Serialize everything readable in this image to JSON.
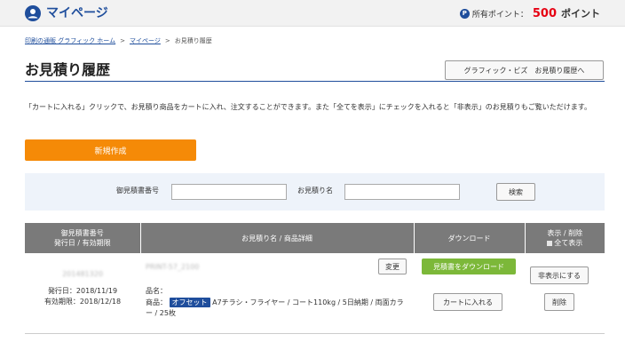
{
  "header": {
    "title": "マイページ",
    "points_icon": "P",
    "points_label": "所有ポイント：",
    "points_value": "500",
    "points_unit": "ポイント"
  },
  "breadcrumb": {
    "items": [
      "印刷の通販 グラフィック ホーム",
      "マイページ",
      "お見積り履歴"
    ],
    "separator": ">"
  },
  "page": {
    "title": "お見積り履歴",
    "history_button": "グラフィック・ビズ　お見積り履歴へ",
    "description": "「カートに入れる」クリックで、お見積り商品をカートに入れ、注文することができます。また「全てを表示」にチェックを入れると「非表示」のお見積りもご覧いただけます。",
    "new_button": "新規作成"
  },
  "search": {
    "number_label": "御見積書番号",
    "number_value": "",
    "name_label": "お見積り名",
    "name_value": "",
    "button": "検索"
  },
  "table": {
    "headers": {
      "number_line1": "御見積書番号",
      "number_line2": "発行日 / 有効期限",
      "name": "お見積り名 / 商品詳細",
      "download": "ダウンロード",
      "show_line1": "表示 / 削除",
      "show_line2": "全て表示"
    },
    "rows": [
      {
        "number": "201481320",
        "issue_date": "発行日：2018/11/19",
        "expiry": "有効期限：2018/12/18",
        "quote_name": "PRINT-57_2100",
        "change_button": "変更",
        "item_label": "品名：",
        "product_prefix": "商品：",
        "product_badge": "オフセット",
        "product_detail": "A7チラシ・フライヤー / コート110kg / 5日納期 / 両面カラー / 25枚",
        "download_button": "見積書をダウンロード",
        "cart_button": "カートに入れる",
        "hide_button": "非表示にする",
        "delete_button": "削除"
      }
    ]
  },
  "colors": {
    "brand": "#1f4e9c",
    "orange": "#f58a07",
    "green": "#7cb839",
    "points_red": "#e60012",
    "header_gray": "#7a7a7a"
  }
}
